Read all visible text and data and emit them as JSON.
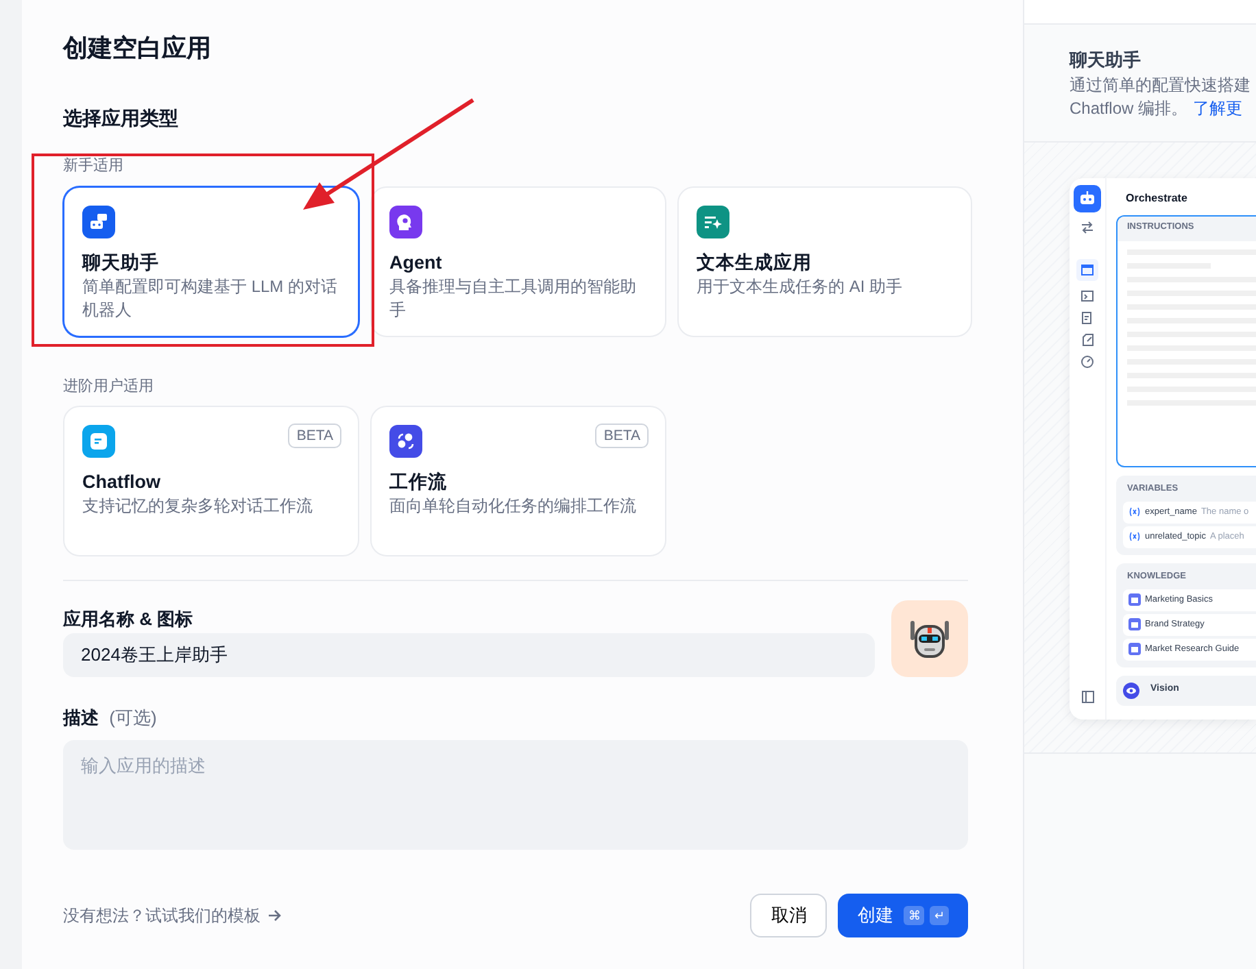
{
  "dialog": {
    "title": "创建空白应用",
    "type_heading": "选择应用类型"
  },
  "app_groups": [
    {
      "label": "新手适用",
      "types": [
        {
          "kind": "chat",
          "name": "聊天助手",
          "description": "简单配置即可构建基于 LLM 的对话机器人",
          "color": "#155eef",
          "selected": true
        },
        {
          "kind": "agent",
          "name": "Agent",
          "description": "具备推理与自主工具调用的智能助手",
          "color": "#7839ee",
          "selected": false
        },
        {
          "kind": "text",
          "name": "文本生成应用",
          "description": "用于文本生成任务的 AI 助手",
          "color": "#0e9384",
          "selected": false
        }
      ]
    },
    {
      "label": "进阶用户适用",
      "types": [
        {
          "kind": "chatflow",
          "name": "Chatflow",
          "description": "支持记忆的复杂多轮对话工作流",
          "color": "#0ba5ec",
          "selected": false,
          "badge": "BETA"
        },
        {
          "kind": "workflow",
          "name": "工作流",
          "description": "面向单轮自动化任务的编排工作流",
          "color": "#444ce7",
          "selected": false,
          "badge": "BETA"
        }
      ]
    }
  ],
  "name_field": {
    "label": "应用名称 & 图标",
    "value": "2024卷王上岸助手"
  },
  "description_field": {
    "label": "描述",
    "optional": "(可选)",
    "placeholder": "输入应用的描述"
  },
  "template_link": "没有想法？试试我们的模板",
  "buttons": {
    "cancel": "取消",
    "create": "创建",
    "shortcut": [
      "⌘",
      "↵"
    ]
  },
  "preview": {
    "title": "聊天助手",
    "description": "通过简单的配置快速搭建",
    "description_2": "Chatflow 编排。",
    "link": "了解更",
    "card": {
      "title": "Orchestrate",
      "instructions": "INSTRUCTIONS",
      "variables_heading": "VARIABLES",
      "variables": [
        {
          "name": "expert_name",
          "hint": "The name o"
        },
        {
          "name": "unrelated_topic",
          "hint": "A placeh"
        }
      ],
      "knowledge_heading": "KNOWLEDGE",
      "knowledge": [
        "Marketing Basics",
        "Brand Strategy",
        "Market Research Guide"
      ],
      "vision": "Vision"
    }
  },
  "annotation": {
    "highlight_box": true,
    "arrow": true
  }
}
